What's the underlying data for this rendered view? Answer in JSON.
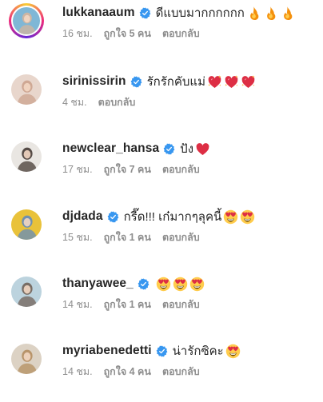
{
  "comments": [
    {
      "username": "lukkanaaum",
      "text": "ดีแบบมากกกกกก",
      "emojis": [
        "fire",
        "fire",
        "fire"
      ],
      "time": "16 ชม.",
      "likes": "ถูกใจ 5 คน",
      "reply": "ตอบกลับ",
      "has_story_ring": true,
      "avatar_colors": [
        "#7fb7d6",
        "#d9b59a"
      ]
    },
    {
      "username": "sirinissirin",
      "text": "รักรักคับแม่",
      "emojis": [
        "sparkling-heart",
        "sparkling-heart",
        "sparkling-heart"
      ],
      "time": "4 ชม.",
      "likes": "",
      "reply": "ตอบกลับ",
      "has_story_ring": false,
      "avatar_colors": [
        "#e8d6cc",
        "#caa08a"
      ]
    },
    {
      "username": "newclear_hansa",
      "text": "ปัง",
      "emojis": [
        "red-heart"
      ],
      "time": "17 ชม.",
      "likes": "ถูกใจ 7 คน",
      "reply": "ตอบกลับ",
      "has_story_ring": false,
      "avatar_colors": [
        "#e9e6e2",
        "#3b2f2a"
      ]
    },
    {
      "username": "djdada",
      "text": "กรี๊ด!!! เก๋มากๆลุคนี้",
      "emojis": [
        "heart-eyes",
        "heart-eyes"
      ],
      "time": "15 ชม.",
      "likes": "ถูกใจ 1 คน",
      "reply": "ตอบกลับ",
      "has_story_ring": false,
      "avatar_colors": [
        "#e9c23a",
        "#5a87c4"
      ]
    },
    {
      "username": "thanyawee_",
      "text": "",
      "emojis": [
        "heart-eyes",
        "heart-eyes",
        "heart-eyes"
      ],
      "time": "14 ชม.",
      "likes": "ถูกใจ 1 คน",
      "reply": "ตอบกลับ",
      "has_story_ring": false,
      "avatar_colors": [
        "#bcd3de",
        "#6c5a50"
      ]
    },
    {
      "username": "myriabenedetti",
      "text": "น่ารักซิคะ",
      "emojis": [
        "heart-eyes"
      ],
      "time": "14 ชม.",
      "likes": "ถูกใจ 4 คน",
      "reply": "ตอบกลับ",
      "has_story_ring": false,
      "avatar_colors": [
        "#dcd2c4",
        "#b18a5a"
      ]
    }
  ],
  "colors": {
    "verified": "#3897f0",
    "meta": "#8e8e8e",
    "text": "#262626"
  }
}
